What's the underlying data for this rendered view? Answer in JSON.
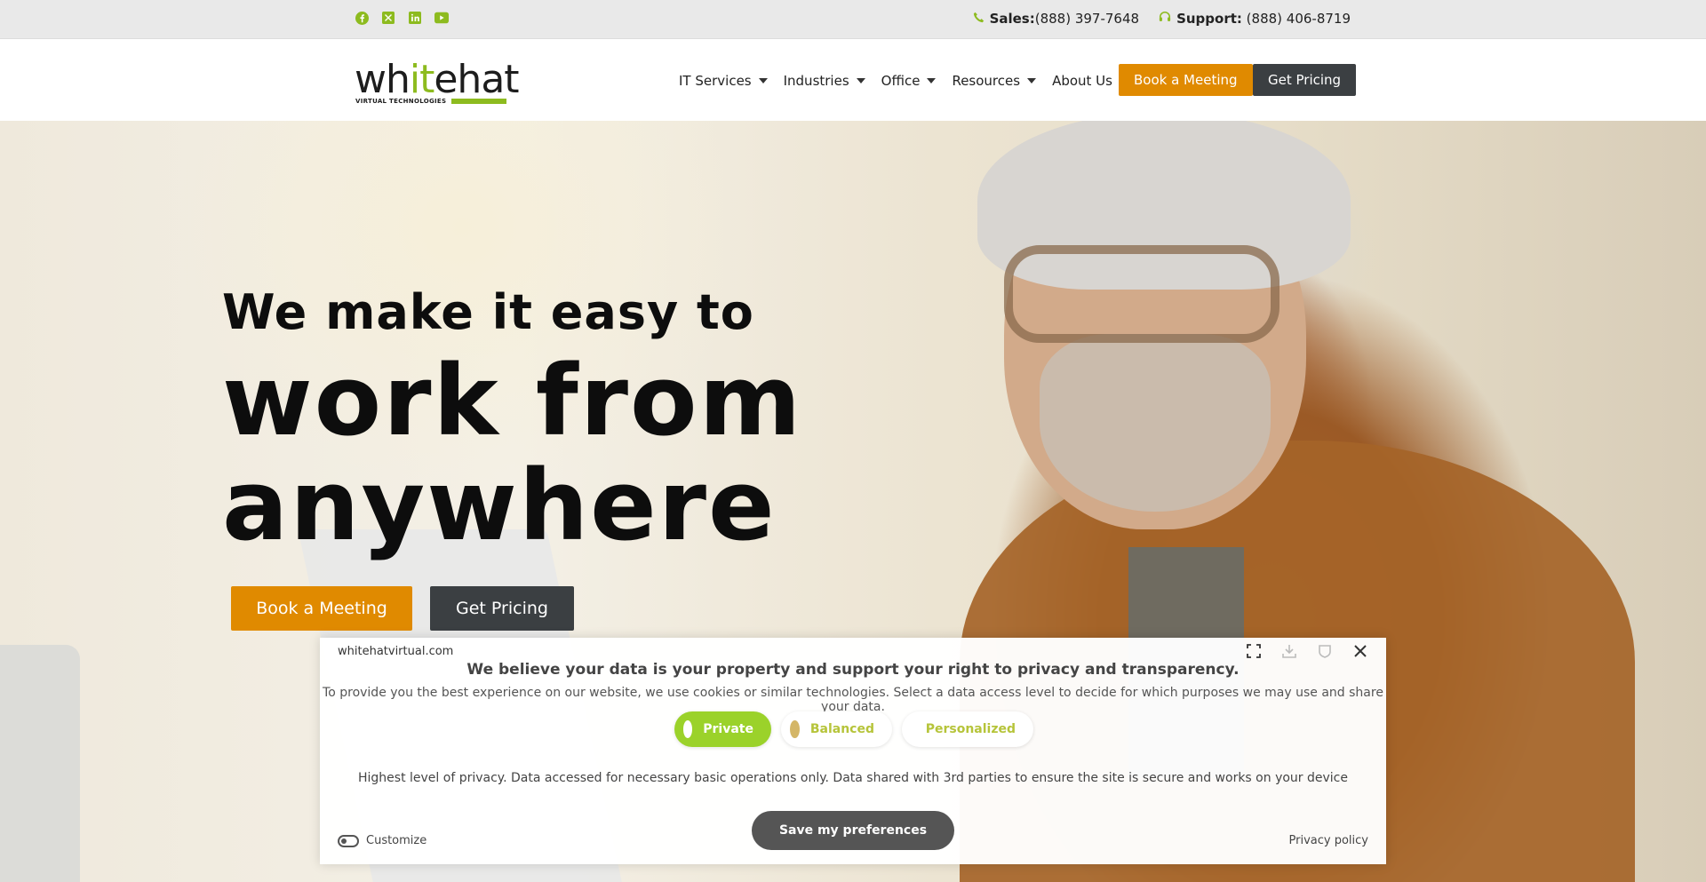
{
  "topbar": {
    "social": [
      {
        "icon": "facebook-icon"
      },
      {
        "icon": "x-twitter-icon"
      },
      {
        "icon": "linkedin-icon"
      },
      {
        "icon": "youtube-icon"
      }
    ],
    "sales_label": "Sales:",
    "sales_phone": "(888) 397-7648",
    "support_label": "Support:",
    "support_phone": "(888) 406-8719",
    "accent_color": "#8dbb1f"
  },
  "header": {
    "logo": {
      "word_a": "wh",
      "word_b": "it",
      "word_c": "ehat",
      "tagline": "VIRTUAL TECHNOLOGIES"
    },
    "nav": [
      "IT Services",
      "Industries",
      "Office",
      "Resources",
      "About Us"
    ],
    "book_meeting": "Book a Meeting",
    "get_pricing": "Get Pricing"
  },
  "hero": {
    "line1": "We make it easy to",
    "line2": "work from",
    "line3": "anywhere",
    "book_meeting": "Book a Meeting",
    "get_pricing": "Get Pricing",
    "orange": "#e08a00",
    "dark": "#3b3f42"
  },
  "privacy": {
    "domain": "whitehatvirtual.com",
    "title": "We believe your data is your property and support your right to privacy and transparency.",
    "description": "To provide you the best experience on our website, we use cookies or similar technologies. Select a data access level to decide for which purposes we may use and share your data.",
    "levels": [
      "Private",
      "Balanced",
      "Personalized"
    ],
    "selected_level": "Private",
    "info": "Highest level of privacy. Data accessed for necessary basic operations only. Data shared with 3rd parties to ensure the site is secure and works on your device",
    "save": "Save my preferences",
    "customize": "Customize",
    "policy": "Privacy policy",
    "icons": [
      "expand-icon",
      "download-icon",
      "shield-icon",
      "close-icon"
    ]
  }
}
